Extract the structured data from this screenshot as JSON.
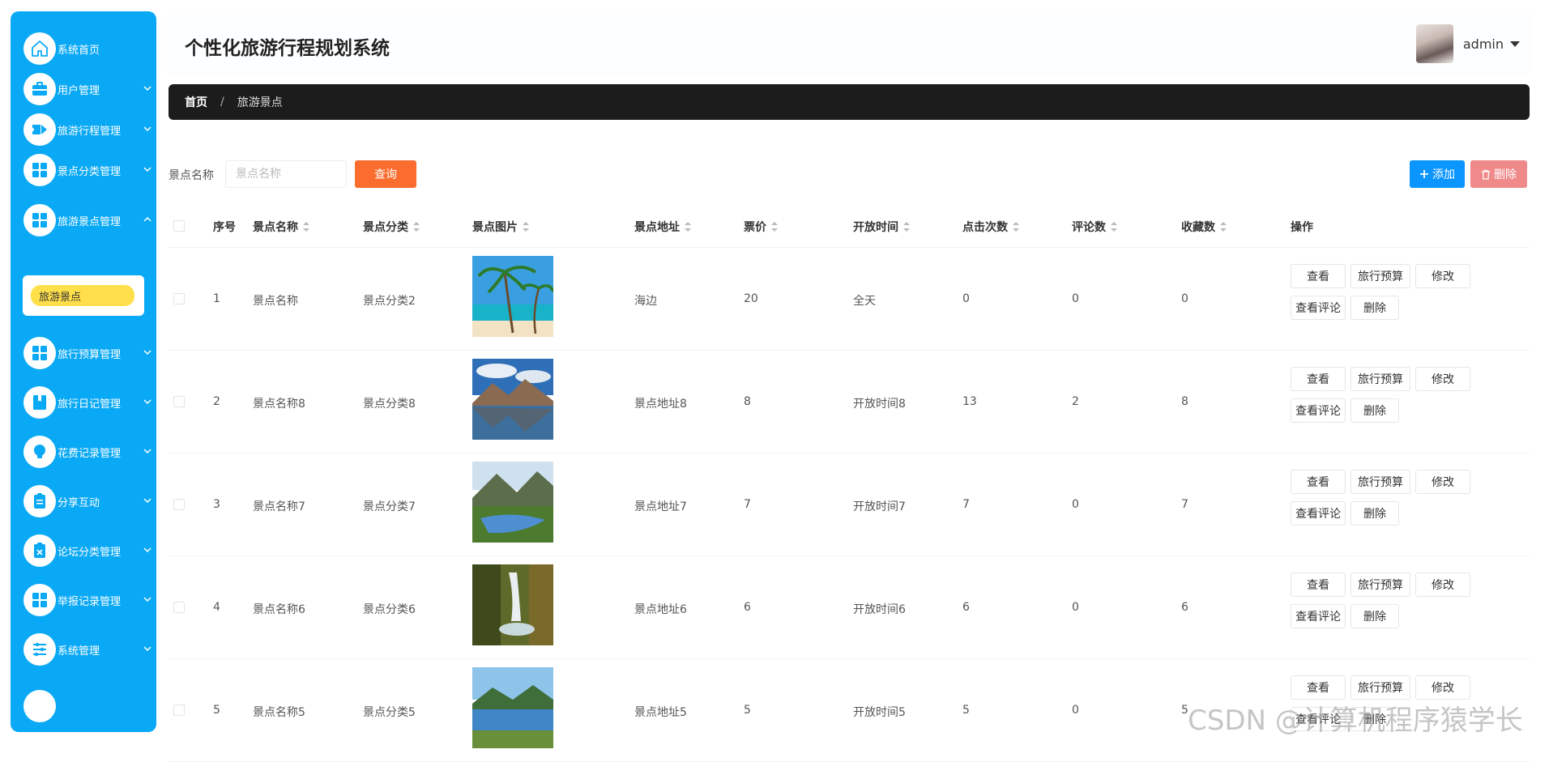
{
  "sidebar": {
    "items": [
      {
        "label": "系统首页",
        "icon": "home-icon"
      },
      {
        "label": "用户管理",
        "icon": "briefcase-icon"
      },
      {
        "label": "旅游行程管理",
        "icon": "ticket-icon"
      },
      {
        "label": "景点分类管理",
        "icon": "grid-icon"
      },
      {
        "label": "旅游景点管理",
        "icon": "grid-icon"
      },
      {
        "label": "旅行预算管理",
        "icon": "grid-icon"
      },
      {
        "label": "旅行日记管理",
        "icon": "book-icon"
      },
      {
        "label": "花费记录管理",
        "icon": "bulb-icon"
      },
      {
        "label": "分享互动",
        "icon": "clipboard-icon"
      },
      {
        "label": "论坛分类管理",
        "icon": "clipboard-x-icon"
      },
      {
        "label": "举报记录管理",
        "icon": "grid-icon"
      },
      {
        "label": "系统管理",
        "icon": "sliders-icon"
      }
    ],
    "active_sub": "旅游景点"
  },
  "header": {
    "title": "个性化旅游行程规划系统",
    "user": "admin"
  },
  "breadcrumb": {
    "home": "首页",
    "separator": "/",
    "current": "旅游景点"
  },
  "toolbar": {
    "search_label": "景点名称",
    "search_placeholder": "景点名称",
    "search_value": "",
    "query_label": "查询",
    "add_label": "添加",
    "delete_label": "删除"
  },
  "table": {
    "columns": [
      "序号",
      "景点名称",
      "景点分类",
      "景点图片",
      "景点地址",
      "票价",
      "开放时间",
      "点击次数",
      "评论数",
      "收藏数",
      "操作"
    ],
    "rows": [
      {
        "index": "1",
        "name": "景点名称",
        "category": "景点分类2",
        "address": "海边",
        "price": "20",
        "hours": "全天",
        "clicks": "0",
        "comments": "0",
        "favorites": "0",
        "image": "beach-palm"
      },
      {
        "index": "2",
        "name": "景点名称8",
        "category": "景点分类8",
        "address": "景点地址8",
        "price": "8",
        "hours": "开放时间8",
        "clicks": "13",
        "comments": "2",
        "favorites": "8",
        "image": "mountain-lake"
      },
      {
        "index": "3",
        "name": "景点名称7",
        "category": "景点分类7",
        "address": "景点地址7",
        "price": "7",
        "hours": "开放时间7",
        "clicks": "7",
        "comments": "0",
        "favorites": "7",
        "image": "valley-river"
      },
      {
        "index": "4",
        "name": "景点名称6",
        "category": "景点分类6",
        "address": "景点地址6",
        "price": "6",
        "hours": "开放时间6",
        "clicks": "6",
        "comments": "0",
        "favorites": "6",
        "image": "waterfall"
      },
      {
        "index": "5",
        "name": "景点名称5",
        "category": "景点分类5",
        "address": "景点地址5",
        "price": "5",
        "hours": "开放时间5",
        "clicks": "5",
        "comments": "0",
        "favorites": "5",
        "image": "lake-forest"
      }
    ],
    "actions": {
      "view": "查看",
      "budget": "旅行预算",
      "edit": "修改",
      "comments": "查看评论",
      "delete": "删除"
    }
  },
  "colors": {
    "sidebar": "#0aa9f5",
    "submenu_active": "#ffe04a",
    "query_button": "#fb6d2e",
    "add_button": "#0b95ff",
    "delete_button": "#f08a8a",
    "breadcrumb_bg": "#1c1c1c"
  },
  "watermark": "CSDN @计算机程序猿学长"
}
